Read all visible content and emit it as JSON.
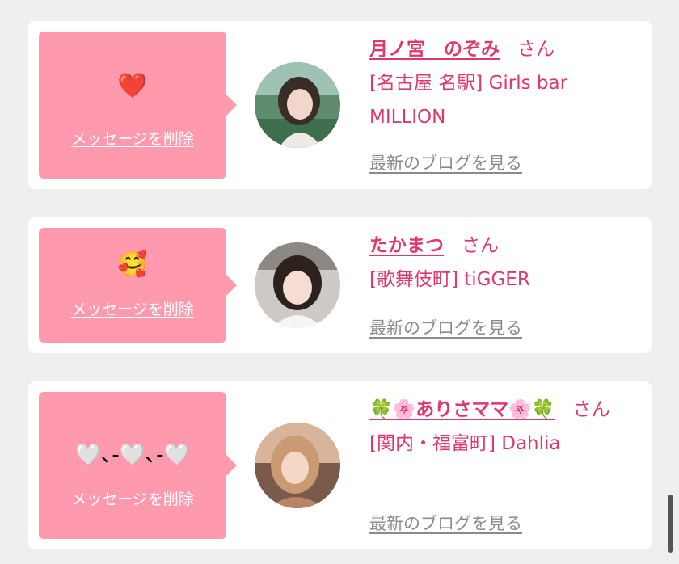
{
  "cards": [
    {
      "message": "❤️",
      "delete_label": "メッセージを削除",
      "name": "月ノ宮　のぞみ",
      "honorific": "さん",
      "shop": "[名古屋 名駅] Girls bar MILLION",
      "blog_label": "最新のブログを見る"
    },
    {
      "message": "🥰",
      "delete_label": "メッセージを削除",
      "name": "たかまつ",
      "honorific": "さん",
      "shop": "[歌舞伎町] tiGGER",
      "blog_label": "最新のブログを見る"
    },
    {
      "message": "🤍､-🤍､-🤍",
      "delete_label": "メッセージを削除",
      "name": "🍀🌸ありさママ🌸🍀",
      "honorific": "さん",
      "shop": "[関内・福富町] Dahlia",
      "blog_label": "最新のブログを見る"
    }
  ],
  "colors": {
    "bubble": "#ff9aae",
    "name": "#e0386c",
    "blog_link": "#8a8a8a",
    "background": "#efefef"
  }
}
